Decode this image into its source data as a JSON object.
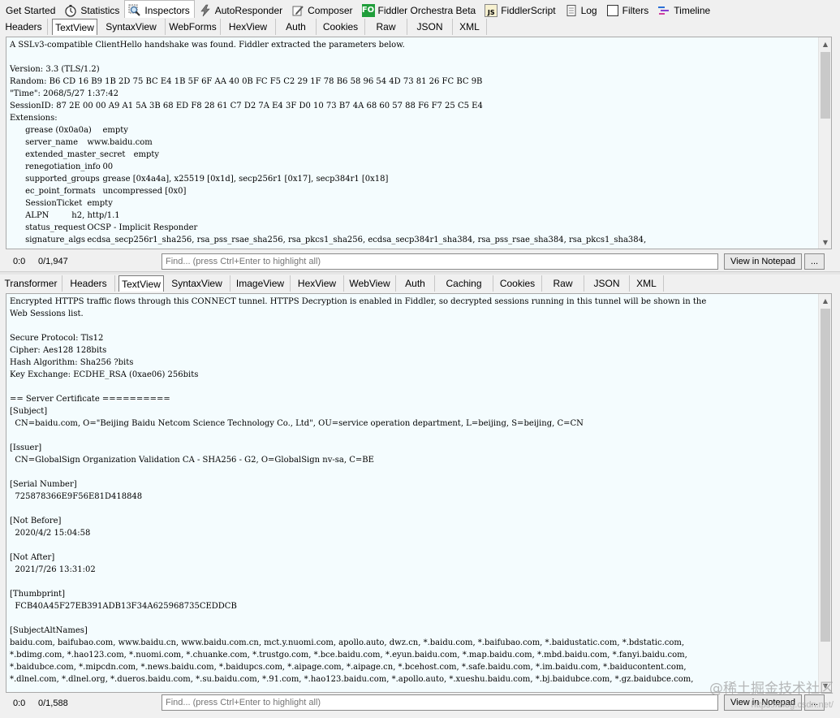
{
  "main_tabs": [
    {
      "label": "Get Started",
      "icon": "none"
    },
    {
      "label": "Statistics",
      "icon": "stopwatch-icon"
    },
    {
      "label": "Inspectors",
      "icon": "magnifier-icon"
    },
    {
      "label": "AutoResponder",
      "icon": "lightning-icon"
    },
    {
      "label": "Composer",
      "icon": "pencil-icon"
    },
    {
      "label": "Fiddler Orchestra Beta",
      "icon": "fo-icon",
      "badge": "FO"
    },
    {
      "label": "FiddlerScript",
      "icon": "js-icon",
      "badge": "JS"
    },
    {
      "label": "Log",
      "icon": "log-icon"
    },
    {
      "label": "Filters",
      "icon": "checkbox-icon"
    },
    {
      "label": "Timeline",
      "icon": "timeline-icon"
    }
  ],
  "request_tabs": [
    "Headers",
    "TextView",
    "SyntaxView",
    "WebForms",
    "HexView",
    "Auth",
    "Cookies",
    "Raw",
    "JSON",
    "XML"
  ],
  "request_text": "A SSLv3-compatible ClientHello handshake was found. Fiddler extracted the parameters below.\n\nVersion: 3.3 (TLS/1.2)\nRandom: B6 CD 16 B9 1B 2D 75 BC E4 1B 5F 6F AA 40 0B FC F5 C2 29 1F 78 B6 58 96 54 4D 73 81 26 FC BC 9B\n\"Time\": 2068/5/27 1:37:42\nSessionID: 87 2E 00 00 A9 A1 5A 3B 68 ED F8 28 61 C7 D2 7A E4 3F D0 10 73 B7 4A 68 60 57 88 F6 F7 25 C5 E4\nExtensions:\n\tgrease (0x0a0a)\tempty\n\tserver_name\twww.baidu.com\n\textended_master_secret\tempty\n\trenegotiation_info\t00\n\tsupported_groups\tgrease [0x4a4a], x25519 [0x1d], secp256r1 [0x17], secp384r1 [0x18]\n\tec_point_formats\tuncompressed [0x0]\n\tSessionTicket\tempty\n\tALPN\t\th2, http/1.1\n\tstatus_request\tOCSP - Implicit Responder\n\tsignature_algs\tecdsa_secp256r1_sha256, rsa_pss_rsae_sha256, rsa_pkcs1_sha256, ecdsa_secp384r1_sha384, rsa_pss_rsae_sha384, rsa_pkcs1_sha384,",
  "request_find": {
    "position": "0:0",
    "count": "0/1,947",
    "placeholder": "Find... (press Ctrl+Enter to highlight all)",
    "notepad_label": "View in Notepad",
    "more_label": "..."
  },
  "response_tabs": [
    "Transformer",
    "Headers",
    "TextView",
    "SyntaxView",
    "ImageView",
    "HexView",
    "WebView",
    "Auth",
    "Caching",
    "Cookies",
    "Raw",
    "JSON",
    "XML"
  ],
  "response_text": "Encrypted HTTPS traffic flows through this CONNECT tunnel. HTTPS Decryption is enabled in Fiddler, so decrypted sessions running in this tunnel will be shown in the\nWeb Sessions list.\n\nSecure Protocol: Tls12\nCipher: Aes128 128bits\nHash Algorithm: Sha256 ?bits\nKey Exchange: ECDHE_RSA (0xae06) 256bits\n\n== Server Certificate ==========\n[Subject]\n  CN=baidu.com, O=\"Beijing Baidu Netcom Science Technology Co., Ltd\", OU=service operation department, L=beijing, S=beijing, C=CN\n\n[Issuer]\n  CN=GlobalSign Organization Validation CA - SHA256 - G2, O=GlobalSign nv-sa, C=BE\n\n[Serial Number]\n  725878366E9F56E81D418848\n\n[Not Before]\n  2020/4/2 15:04:58\n\n[Not After]\n  2021/7/26 13:31:02\n\n[Thumbprint]\n  FCB40A45F27EB391ADB13F34A625968735CEDDCB\n\n[SubjectAltNames]\nbaidu.com, baifubao.com, www.baidu.cn, www.baidu.com.cn, mct.y.nuomi.com, apollo.auto, dwz.cn, *.baidu.com, *.baifubao.com, *.baidustatic.com, *.bdstatic.com,\n*.bdimg.com, *.hao123.com, *.nuomi.com, *.chuanke.com, *.trustgo.com, *.bce.baidu.com, *.eyun.baidu.com, *.map.baidu.com, *.mbd.baidu.com, *.fanyi.baidu.com,\n*.baidubce.com, *.mipcdn.com, *.news.baidu.com, *.baidupcs.com, *.aipage.com, *.aipage.cn, *.bcehost.com, *.safe.baidu.com, *.im.baidu.com, *.baiducontent.com,\n*.dlnel.com, *.dlnel.org, *.dueros.baidu.com, *.su.baidu.com, *.91.com, *.hao123.baidu.com, *.apollo.auto, *.xueshu.baidu.com, *.bj.baidubce.com, *.gz.baidubce.com,",
  "response_find": {
    "position": "0:0",
    "count": "0/1,588",
    "placeholder": "Find... (press Ctrl+Enter to highlight all)",
    "notepad_label": "View in Notepad",
    "more_label": "..."
  },
  "watermark": "@稀土掘金技术社区",
  "watermark_url": "https://blog.csdn.net/"
}
